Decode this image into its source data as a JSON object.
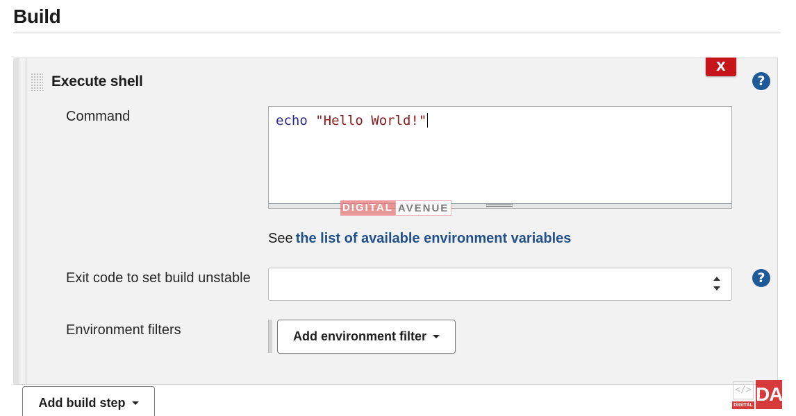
{
  "section": {
    "title": "Build"
  },
  "step": {
    "title": "Execute shell",
    "delete_label": "X",
    "help_label": "?"
  },
  "command": {
    "label": "Command",
    "keyword": "echo",
    "argument": "\"Hello World!\""
  },
  "env_help": {
    "prefix": "See",
    "link_text": "the list of available environment variables"
  },
  "exit_code": {
    "label": "Exit code to set build unstable",
    "value": "",
    "help_label": "?"
  },
  "env_filters": {
    "label": "Environment filters",
    "button_label": "Add environment filter"
  },
  "add_build_step": {
    "label": "Add build step"
  },
  "watermark": {
    "part1": "DIGITAL",
    "part2": "AVENUE"
  },
  "logo": {
    "code_glyph": "</>",
    "small_text": "DIGITAL",
    "initials": "DA"
  },
  "colors": {
    "delete_red": "#c8141b",
    "help_blue": "#1d5a97",
    "link_blue": "#1f4f8c",
    "panel_bg": "#f2f2f2"
  }
}
